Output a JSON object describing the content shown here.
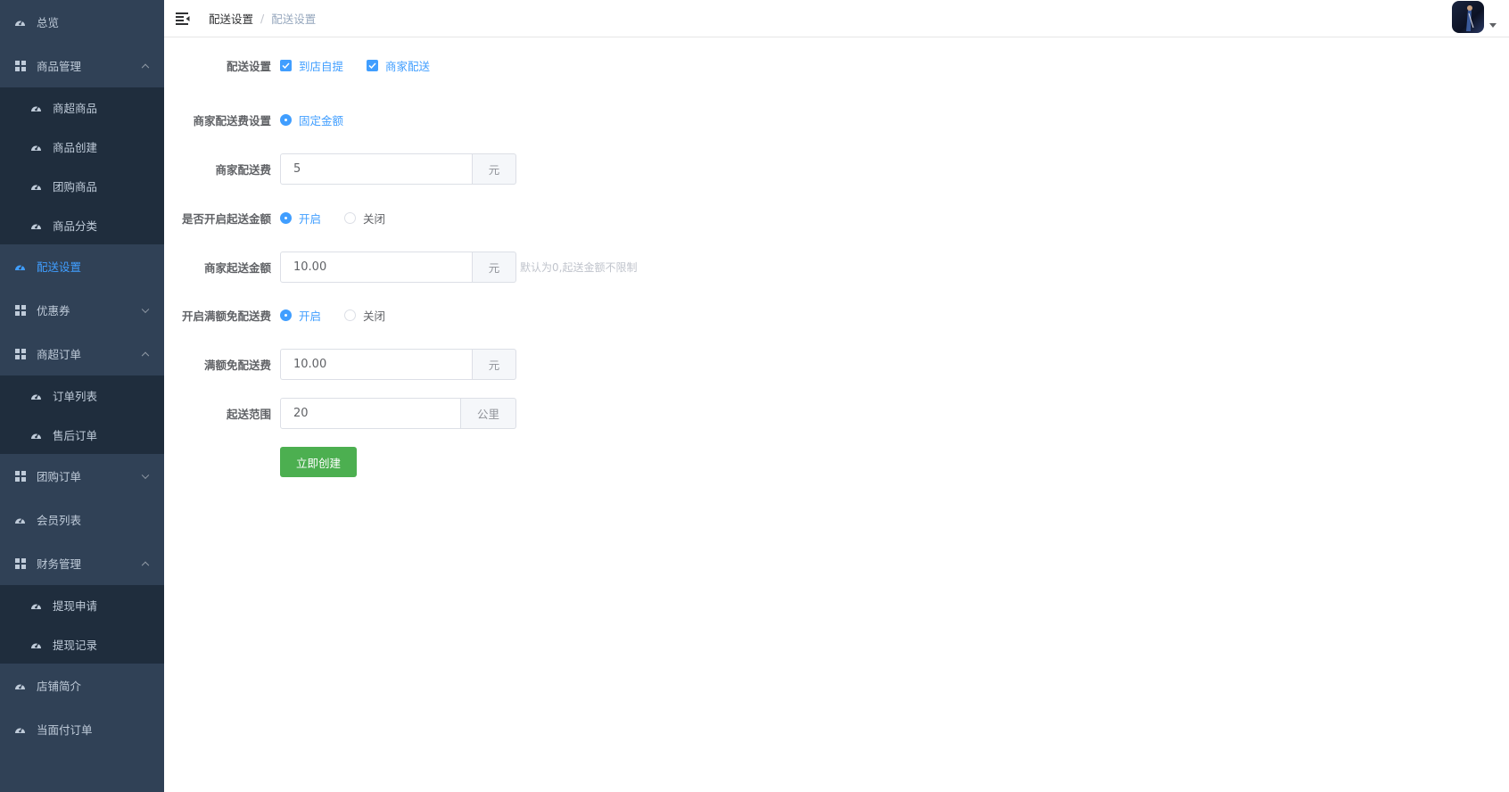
{
  "sidebar": {
    "overview": "总览",
    "goods": {
      "label": "商品管理",
      "items": [
        "商超商品",
        "商品创建",
        "团购商品",
        "商品分类"
      ]
    },
    "delivery": "配送设置",
    "coupon": "优惠券",
    "mall_orders": {
      "label": "商超订单",
      "items": [
        "订单列表",
        "售后订单"
      ]
    },
    "group_orders": "团购订单",
    "members": "会员列表",
    "finance": {
      "label": "财务管理",
      "items": [
        "提现申请",
        "提现记录"
      ]
    },
    "shop_intro": "店铺简介",
    "face_pay": "当面付订单"
  },
  "breadcrumb": {
    "level1": "配送设置",
    "separator": "/",
    "level2": "配送设置"
  },
  "form": {
    "delivery_mode": {
      "label": "配送设置",
      "options": [
        "到店自提",
        "商家配送"
      ]
    },
    "fee_type": {
      "label": "商家配送费设置",
      "option": "固定金额"
    },
    "fee": {
      "label": "商家配送费",
      "value": "5",
      "unit": "元"
    },
    "min_switch": {
      "label": "是否开启起送金额",
      "on": "开启",
      "off": "关闭"
    },
    "min_amount": {
      "label": "商家起送金额",
      "value": "10.00",
      "unit": "元",
      "hint": "默认为0,起送金额不限制"
    },
    "free_switch": {
      "label": "开启满额免配送费",
      "on": "开启",
      "off": "关闭"
    },
    "free_amount": {
      "label": "满额免配送费",
      "value": "10.00",
      "unit": "元"
    },
    "range": {
      "label": "起送范围",
      "value": "20",
      "unit": "公里"
    },
    "submit": "立即创建"
  },
  "colors": {
    "sidebar_bg": "#304156",
    "submenu_bg": "#1f2d3d",
    "active": "#409eff",
    "submit": "#4caf50"
  }
}
